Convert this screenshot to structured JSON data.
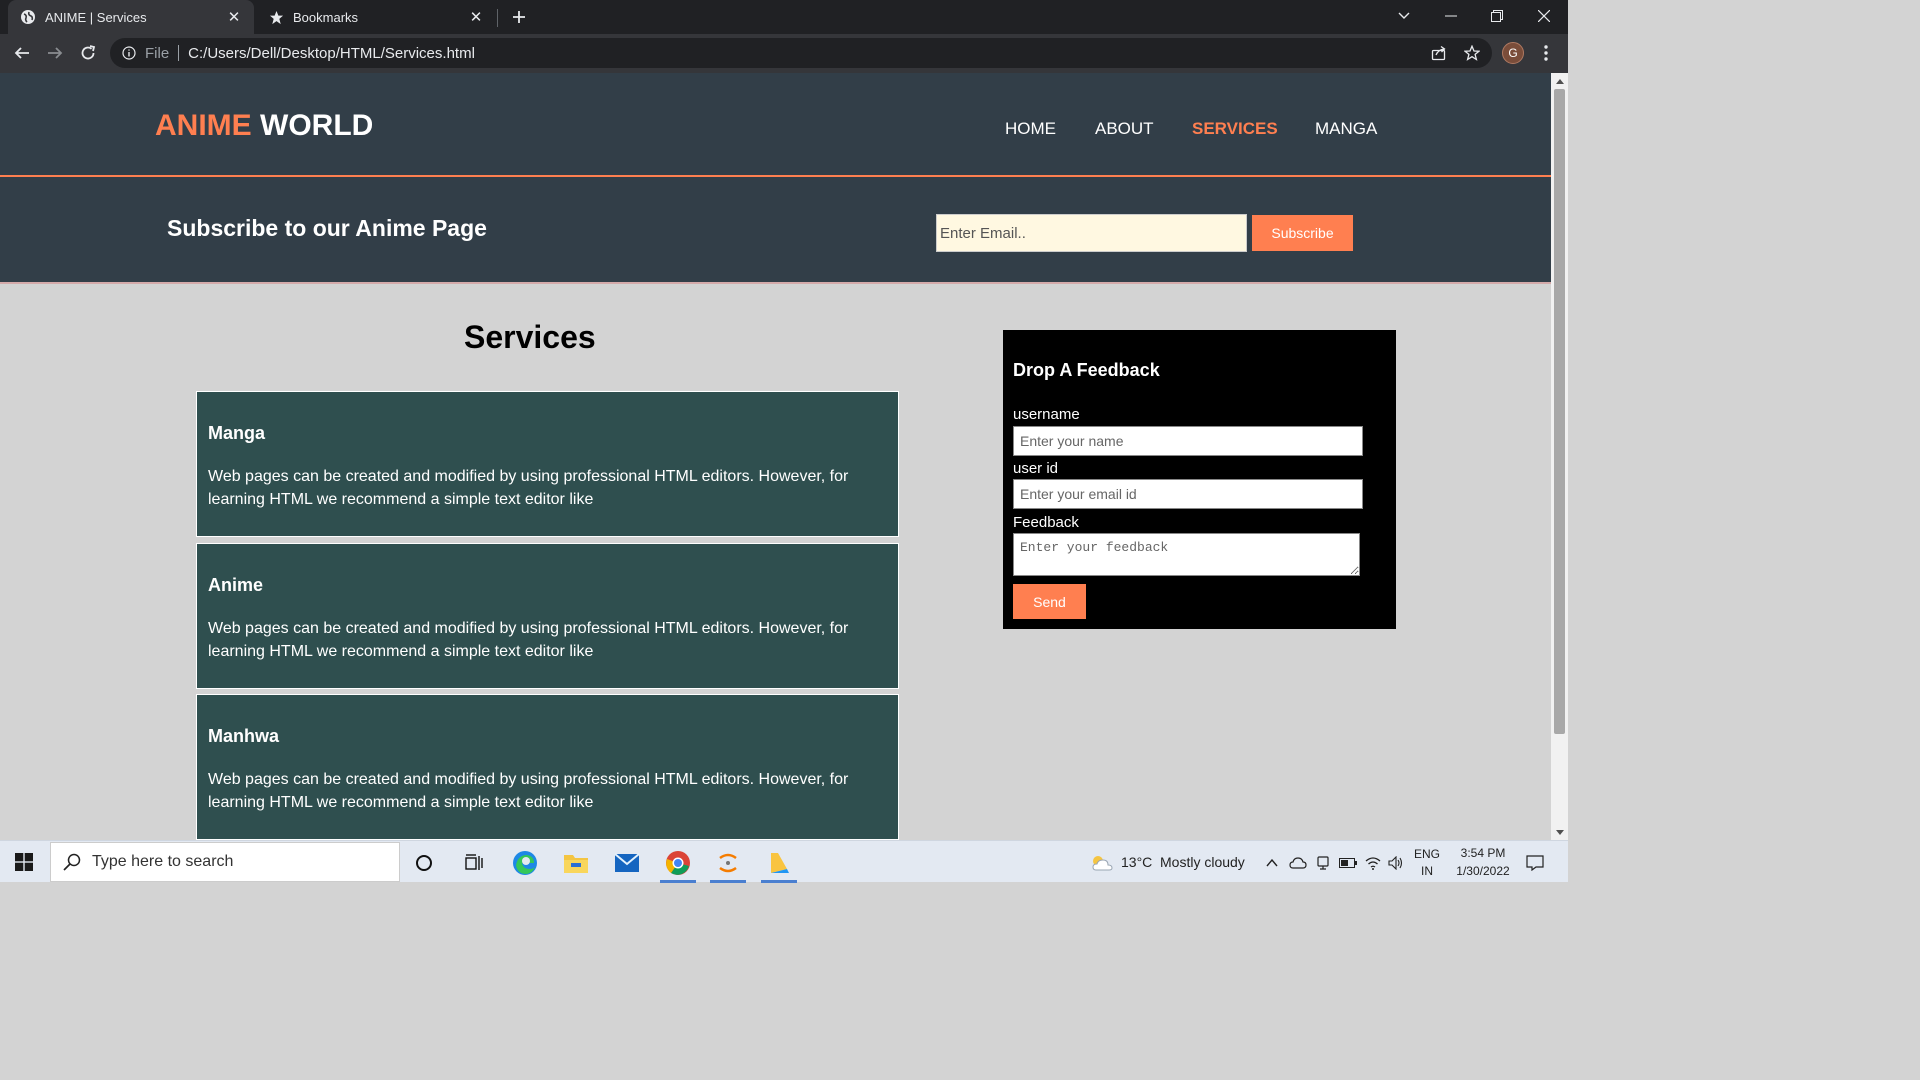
{
  "browser": {
    "tabs": [
      {
        "title": "ANIME | Services",
        "icon": "globe-icon",
        "active": true
      },
      {
        "title": "Bookmarks",
        "icon": "star-icon",
        "active": false
      }
    ],
    "address": {
      "scheme": "File",
      "url": "C:/Users/Dell/Desktop/HTML/Services.html"
    },
    "profile_initial": "G"
  },
  "site": {
    "logo": {
      "part1": "ANIME",
      "part2": "WORLD"
    },
    "nav": [
      {
        "label": "HOME",
        "active": false
      },
      {
        "label": "ABOUT",
        "active": false
      },
      {
        "label": "SERVICES",
        "active": true
      },
      {
        "label": "MANGA",
        "active": false
      }
    ],
    "subscribe": {
      "title": "Subscribe to our Anime Page",
      "email_placeholder": "Enter Email..",
      "button": "Subscribe"
    },
    "services": {
      "title": "Services",
      "cards": [
        {
          "title": "Manga",
          "text": "Web pages can be created and modified by using professional HTML editors. However, for learning HTML we recommend a simple text editor like"
        },
        {
          "title": "Anime",
          "text": "Web pages can be created and modified by using professional HTML editors. However, for learning HTML we recommend a simple text editor like"
        },
        {
          "title": "Manhwa",
          "text": "Web pages can be created and modified by using professional HTML editors. However, for learning HTML we recommend a simple text editor like"
        }
      ]
    },
    "feedback": {
      "title": "Drop A Feedback",
      "username_label": "username",
      "username_placeholder": "Enter your name",
      "userid_label": "user id",
      "userid_placeholder": "Enter your email id",
      "feedback_label": "Feedback",
      "feedback_placeholder": "Enter your feedback",
      "send": "Send"
    }
  },
  "colors": {
    "accent": "#ff7f50",
    "header_bg": "#323e48",
    "card_bg": "#2f4f4f",
    "page_bg": "#d3d3d3"
  },
  "taskbar": {
    "search_placeholder": "Type here to search",
    "weather": {
      "temp": "13°C",
      "condition": "Mostly cloudy"
    },
    "lang": {
      "line1": "ENG",
      "line2": "IN"
    },
    "clock": {
      "time": "3:54 PM",
      "date": "1/30/2022"
    }
  }
}
